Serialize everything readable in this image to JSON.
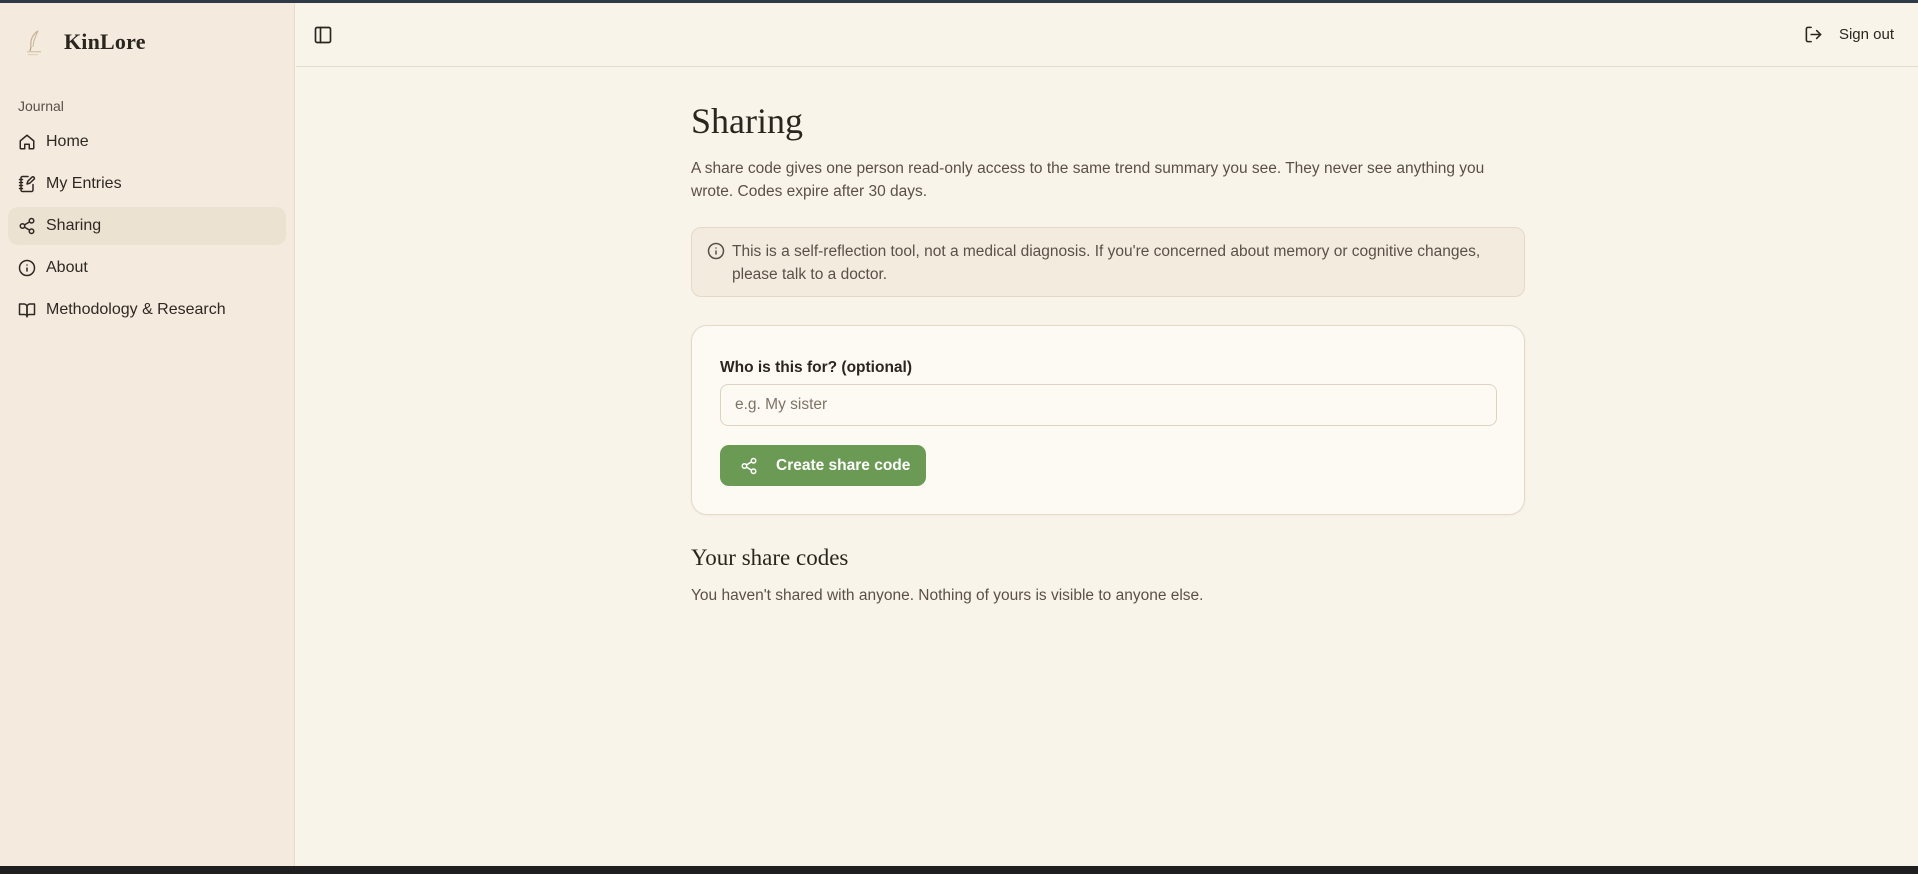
{
  "app": {
    "name": "KinLore"
  },
  "sidebar": {
    "section_label": "Journal",
    "items": [
      {
        "label": "Home",
        "icon": "home-icon"
      },
      {
        "label": "My Entries",
        "icon": "notebook-pen-icon"
      },
      {
        "label": "Sharing",
        "icon": "share-icon",
        "active": true
      },
      {
        "label": "About",
        "icon": "info-icon"
      },
      {
        "label": "Methodology & Research",
        "icon": "book-open-icon"
      }
    ]
  },
  "topbar": {
    "sign_out_label": "Sign out"
  },
  "main": {
    "title": "Sharing",
    "description": "A share code gives one person read-only access to the same trend summary you see. They never see anything you wrote. Codes expire after 30 days.",
    "notice": "This is a self-reflection tool, not a medical diagnosis. If you're concerned about memory or cognitive changes, please talk to a doctor.",
    "form": {
      "label": "Who is this for? (optional)",
      "placeholder": "e.g. My sister",
      "value": "",
      "button_label": "Create share code"
    },
    "codes_title": "Your share codes",
    "empty_text": "You haven't shared with anyone. Nothing of yours is visible to anyone else."
  },
  "colors": {
    "background": "#f9f4ea",
    "sidebar": "#f4ebde",
    "accent": "#6b9a54",
    "text": "#2b2520"
  }
}
